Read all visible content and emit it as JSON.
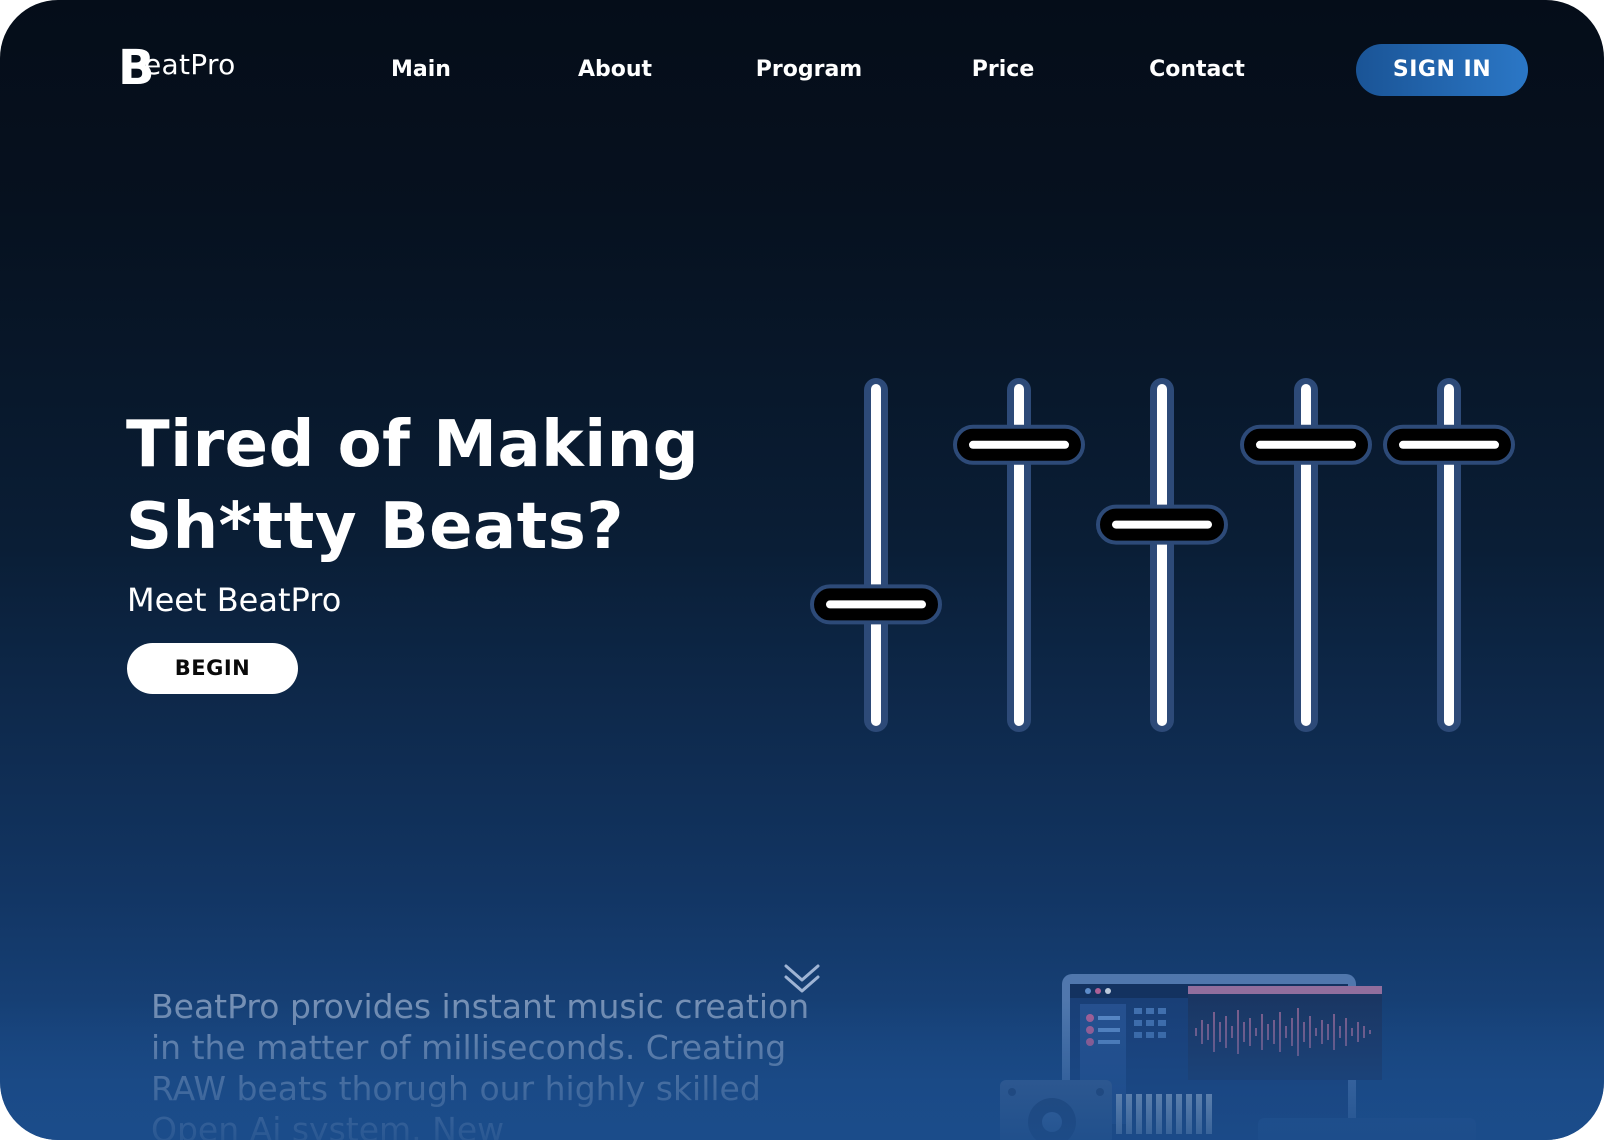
{
  "header": {
    "logo": {
      "initial": "B",
      "rest": "eatPro"
    },
    "nav": [
      {
        "label": "Main"
      },
      {
        "label": "About"
      },
      {
        "label": "Program"
      },
      {
        "label": "Price"
      },
      {
        "label": "Contact"
      }
    ],
    "sign_in_label": "SIGN IN"
  },
  "hero": {
    "headline_line1": "Tired of Making",
    "headline_line2": "Sh*tty Beats?",
    "subheadline": "Meet BeatPro",
    "cta_label": "BEGIN"
  },
  "mixer": {
    "fader_levels": [
      0.2,
      0.9,
      0.55,
      0.9,
      0.9
    ]
  },
  "scroll_hint_icon": "double-chevron-down-icon",
  "about": {
    "description": "BeatPro provides instant music creation in the matter of milliseconds. Creating RAW beats thorugh our highly skilled Open Ai system. New"
  },
  "illustration": {
    "icon": "laptop-daw-illustration"
  },
  "colors": {
    "accent": "#2b77c6",
    "background_top": "#050d19",
    "background_bottom": "#1b4c8a",
    "fader_track": "#2d4a78",
    "fader_cap": "#000000"
  }
}
